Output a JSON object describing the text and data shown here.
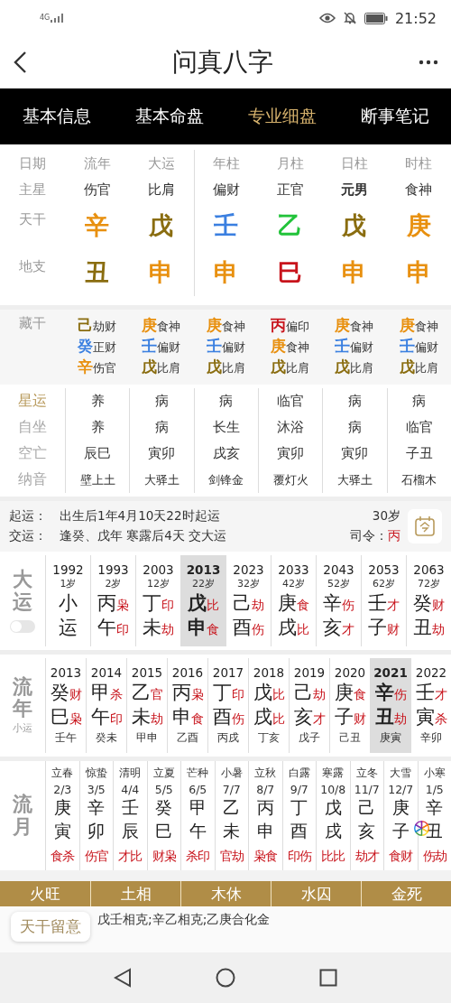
{
  "status_bar": {
    "network": "4G",
    "time": "21:52"
  },
  "header": {
    "title": "问真八字"
  },
  "tabs": [
    {
      "label": "基本信息",
      "selected": false
    },
    {
      "label": "基本命盘",
      "selected": false
    },
    {
      "label": "专业细盘",
      "selected": true
    },
    {
      "label": "断事笔记",
      "selected": false
    }
  ],
  "pillars": {
    "row_labels": [
      "日期",
      "主星",
      "天干",
      "地支"
    ],
    "columns": [
      {
        "header": "流年",
        "main_star": "伤官",
        "emphasis": false,
        "stem": {
          "char": "辛",
          "color": "#e8900f"
        },
        "branch": {
          "char": "丑",
          "color": "#8a6d10"
        }
      },
      {
        "header": "大运",
        "main_star": "比肩",
        "emphasis": false,
        "stem": {
          "char": "戊",
          "color": "#8a6d10"
        },
        "branch": {
          "char": "申",
          "color": "#e8900f"
        }
      },
      {
        "header": "年柱",
        "main_star": "偏财",
        "emphasis": false,
        "stem": {
          "char": "壬",
          "color": "#3a7fe0"
        },
        "branch": {
          "char": "申",
          "color": "#e8900f"
        }
      },
      {
        "header": "月柱",
        "main_star": "正官",
        "emphasis": false,
        "stem": {
          "char": "乙",
          "color": "#22c33a"
        },
        "branch": {
          "char": "巳",
          "color": "#c8141c"
        }
      },
      {
        "header": "日柱",
        "main_star": "元男",
        "emphasis": true,
        "stem": {
          "char": "戊",
          "color": "#8a6d10"
        },
        "branch": {
          "char": "申",
          "color": "#e8900f"
        }
      },
      {
        "header": "时柱",
        "main_star": "食神",
        "emphasis": false,
        "stem": {
          "char": "庚",
          "color": "#e8900f"
        },
        "branch": {
          "char": "申",
          "color": "#e8900f"
        }
      }
    ]
  },
  "hidden_stems": {
    "label": "藏干",
    "columns": [
      [
        {
          "char": "己",
          "color": "#8a6d10",
          "god": "劫财"
        },
        {
          "char": "癸",
          "color": "#3a7fe0",
          "god": "正财"
        },
        {
          "char": "辛",
          "color": "#e8900f",
          "god": "伤官"
        }
      ],
      [
        {
          "char": "庚",
          "color": "#e8900f",
          "god": "食神"
        },
        {
          "char": "壬",
          "color": "#3a7fe0",
          "god": "偏财"
        },
        {
          "char": "戊",
          "color": "#8a6d10",
          "god": "比肩"
        }
      ],
      [
        {
          "char": "庚",
          "color": "#e8900f",
          "god": "食神"
        },
        {
          "char": "壬",
          "color": "#3a7fe0",
          "god": "偏财"
        },
        {
          "char": "戊",
          "color": "#8a6d10",
          "god": "比肩"
        }
      ],
      [
        {
          "char": "丙",
          "color": "#c8141c",
          "god": "偏印"
        },
        {
          "char": "庚",
          "color": "#e8900f",
          "god": "食神"
        },
        {
          "char": "戊",
          "color": "#8a6d10",
          "god": "比肩"
        }
      ],
      [
        {
          "char": "庚",
          "color": "#e8900f",
          "god": "食神"
        },
        {
          "char": "壬",
          "color": "#3a7fe0",
          "god": "偏财"
        },
        {
          "char": "戊",
          "color": "#8a6d10",
          "god": "比肩"
        }
      ],
      [
        {
          "char": "庚",
          "color": "#e8900f",
          "god": "食神"
        },
        {
          "char": "壬",
          "color": "#3a7fe0",
          "god": "偏财"
        },
        {
          "char": "戊",
          "color": "#8a6d10",
          "god": "比肩"
        }
      ]
    ]
  },
  "star_rows": [
    {
      "label": "星运",
      "highlighted": true,
      "cells": [
        "养",
        "病",
        "病",
        "临官",
        "病",
        "病"
      ]
    },
    {
      "label": "自坐",
      "highlighted": false,
      "cells": [
        "养",
        "病",
        "长生",
        "沐浴",
        "病",
        "临官"
      ]
    },
    {
      "label": "空亡",
      "highlighted": false,
      "cells": [
        "辰巳",
        "寅卯",
        "戌亥",
        "寅卯",
        "寅卯",
        "子丑"
      ]
    },
    {
      "label": "纳音",
      "highlighted": false,
      "cells": [
        "壁上土",
        "大驿土",
        "剑锋金",
        "覆灯火",
        "大驿土",
        "石榴木"
      ]
    }
  ],
  "luck_info": {
    "lines": [
      {
        "label": "起运：",
        "text": "出生后1年4月10天22时起运"
      },
      {
        "label": "交运：",
        "text": "逢癸、戊年 寒露后4天 交大运"
      }
    ],
    "age": "30岁",
    "siling_label": "司令：",
    "siling_value": "丙"
  },
  "dayun": {
    "label": "大运",
    "toggle_on": false,
    "items": [
      {
        "year": "1992",
        "age": "1岁",
        "stem": "小",
        "branch": "运",
        "selected": false
      },
      {
        "year": "1993",
        "age": "2岁",
        "stem": "丙",
        "stem_god": "枭",
        "branch": "午",
        "branch_god": "印",
        "selected": false
      },
      {
        "year": "2003",
        "age": "12岁",
        "stem": "丁",
        "stem_god": "印",
        "branch": "未",
        "branch_god": "劫",
        "selected": false
      },
      {
        "year": "2013",
        "age": "22岁",
        "stem": "戊",
        "stem_god": "比",
        "branch": "申",
        "branch_god": "食",
        "selected": true
      },
      {
        "year": "2023",
        "age": "32岁",
        "stem": "己",
        "stem_god": "劫",
        "branch": "酉",
        "branch_god": "伤",
        "selected": false
      },
      {
        "year": "2033",
        "age": "42岁",
        "stem": "庚",
        "stem_god": "食",
        "branch": "戌",
        "branch_god": "比",
        "selected": false
      },
      {
        "year": "2043",
        "age": "52岁",
        "stem": "辛",
        "stem_god": "伤",
        "branch": "亥",
        "branch_god": "才",
        "selected": false
      },
      {
        "year": "2053",
        "age": "62岁",
        "stem": "壬",
        "stem_god": "才",
        "branch": "子",
        "branch_god": "财",
        "selected": false
      },
      {
        "year": "2063",
        "age": "72岁",
        "stem": "癸",
        "stem_god": "财",
        "branch": "丑",
        "branch_god": "劫",
        "selected": false
      }
    ]
  },
  "liunian": {
    "label": "流年",
    "sublabel": "小运",
    "items": [
      {
        "year": "2013",
        "stem": "癸",
        "stem_god": "财",
        "branch": "巳",
        "branch_god": "枭",
        "xiaoyun": "壬午",
        "selected": false
      },
      {
        "year": "2014",
        "stem": "甲",
        "stem_god": "杀",
        "branch": "午",
        "branch_god": "印",
        "xiaoyun": "癸未",
        "selected": false
      },
      {
        "year": "2015",
        "stem": "乙",
        "stem_god": "官",
        "branch": "未",
        "branch_god": "劫",
        "xiaoyun": "甲申",
        "selected": false
      },
      {
        "year": "2016",
        "stem": "丙",
        "stem_god": "枭",
        "branch": "申",
        "branch_god": "食",
        "xiaoyun": "乙酉",
        "selected": false
      },
      {
        "year": "2017",
        "stem": "丁",
        "stem_god": "印",
        "branch": "酉",
        "branch_god": "伤",
        "xiaoyun": "丙戌",
        "selected": false
      },
      {
        "year": "2018",
        "stem": "戊",
        "stem_god": "比",
        "branch": "戌",
        "branch_god": "比",
        "xiaoyun": "丁亥",
        "selected": false
      },
      {
        "year": "2019",
        "stem": "己",
        "stem_god": "劫",
        "branch": "亥",
        "branch_god": "才",
        "xiaoyun": "戊子",
        "selected": false
      },
      {
        "year": "2020",
        "stem": "庚",
        "stem_god": "食",
        "branch": "子",
        "branch_god": "财",
        "xiaoyun": "己丑",
        "selected": false
      },
      {
        "year": "2021",
        "stem": "辛",
        "stem_god": "伤",
        "branch": "丑",
        "branch_god": "劫",
        "xiaoyun": "庚寅",
        "selected": true
      },
      {
        "year": "2022",
        "stem": "壬",
        "stem_god": "才",
        "branch": "寅",
        "branch_god": "杀",
        "xiaoyun": "辛卯",
        "selected": false
      }
    ]
  },
  "liuyue": {
    "label": "流月",
    "items": [
      {
        "term": "立春",
        "date": "2/3",
        "stem": "庚",
        "branch": "寅",
        "gods": "食杀"
      },
      {
        "term": "惊蛰",
        "date": "3/5",
        "stem": "辛",
        "branch": "卯",
        "gods": "伤官"
      },
      {
        "term": "清明",
        "date": "4/4",
        "stem": "壬",
        "branch": "辰",
        "gods": "才比"
      },
      {
        "term": "立夏",
        "date": "5/5",
        "stem": "癸",
        "branch": "巳",
        "gods": "财枭"
      },
      {
        "term": "芒种",
        "date": "6/5",
        "stem": "甲",
        "branch": "午",
        "gods": "杀印"
      },
      {
        "term": "小暑",
        "date": "7/7",
        "stem": "乙",
        "branch": "未",
        "gods": "官劫"
      },
      {
        "term": "立秋",
        "date": "8/7",
        "stem": "丙",
        "branch": "申",
        "gods": "枭食"
      },
      {
        "term": "白露",
        "date": "9/7",
        "stem": "丁",
        "branch": "酉",
        "gods": "印伤"
      },
      {
        "term": "寒露",
        "date": "10/8",
        "stem": "戊",
        "branch": "戌",
        "gods": "比比"
      },
      {
        "term": "立冬",
        "date": "11/7",
        "stem": "己",
        "branch": "亥",
        "gods": "劫才"
      },
      {
        "term": "大雪",
        "date": "12/7",
        "stem": "庚",
        "branch": "子",
        "gods": "食财"
      },
      {
        "term": "小寒",
        "date": "1/5",
        "stem": "辛",
        "branch": "丑",
        "gods": "伤劫"
      }
    ]
  },
  "wuxing": [
    "火旺",
    "土相",
    "木休",
    "水囚",
    "金死"
  ],
  "notice": {
    "badge": "天干留意",
    "text": "戊壬相克;辛乙相克;乙庚合化金"
  }
}
